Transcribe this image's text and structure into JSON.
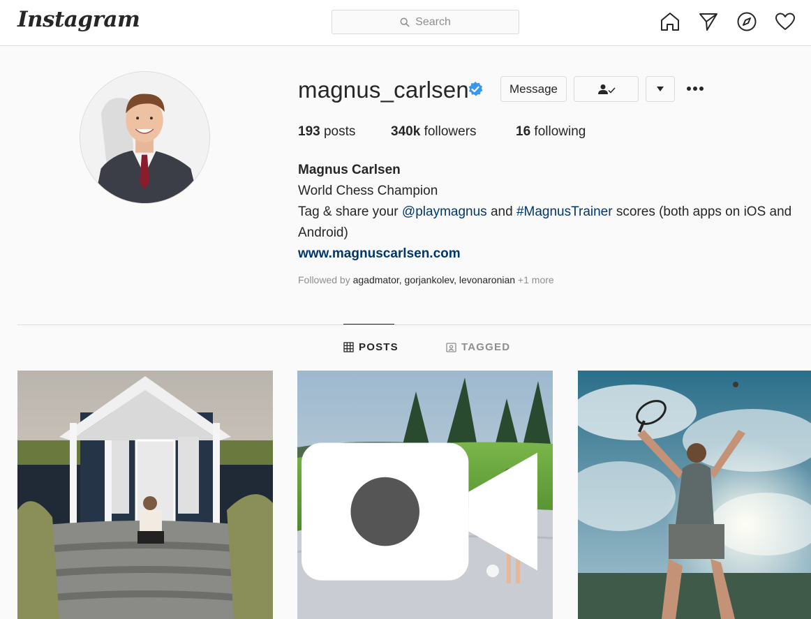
{
  "header": {
    "logo": "Instagram",
    "search_placeholder": "Search",
    "icons": [
      "home-icon",
      "direct-icon",
      "explore-icon",
      "activity-icon"
    ]
  },
  "profile": {
    "username": "magnus_carlsen",
    "verified": true,
    "message_label": "Message",
    "stats": {
      "posts_count": "193",
      "posts_label": "posts",
      "followers_count": "340k",
      "followers_label": "followers",
      "following_count": "16",
      "following_label": "following"
    },
    "bio": {
      "full_name": "Magnus Carlsen",
      "line1": "World Chess Champion",
      "line2_pre": "Tag & share your ",
      "mention": "@playmagnus",
      "line2_mid": " and ",
      "hashtag": "#MagnusTrainer",
      "line2_post": " scores (both apps on iOS and Android)",
      "website": "www.magnuscarlsen.com"
    },
    "followed_by": {
      "prefix": "Followed by ",
      "names": "agadmator, gorjankolev, levonaronian",
      "more": " +1 more"
    }
  },
  "tabs": {
    "posts": "POSTS",
    "tagged": "TAGGED"
  },
  "colors": {
    "link": "#00376b",
    "verified": "#3897f0",
    "border": "#dbdbdb",
    "muted": "#8e8e8e"
  }
}
